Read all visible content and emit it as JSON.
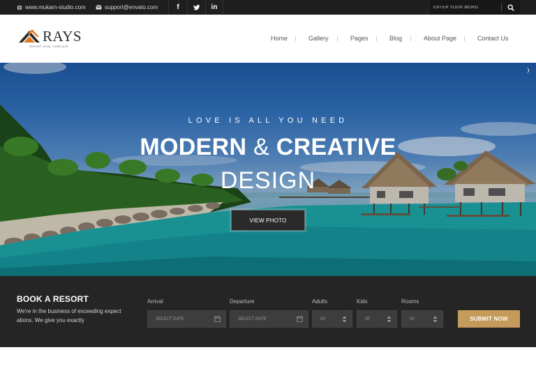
{
  "topbar": {
    "website": "www.mukam-studio.com",
    "email": "support@envato.com",
    "social": [
      {
        "icon": "facebook-icon",
        "glyph": "f"
      },
      {
        "icon": "twitter-icon",
        "glyph": "t"
      },
      {
        "icon": "linkedin-icon",
        "glyph": "in"
      }
    ],
    "search_placeholder": "ENTER YOUR WORD"
  },
  "header": {
    "logo_word": "RAYS",
    "logo_tagline": "RESORT HTML TEMPLATE",
    "nav": [
      "Home",
      "Gallery",
      "Pages",
      "Blog",
      "About Page",
      "Contact Us"
    ]
  },
  "hero": {
    "kicker": "LOVE IS ALL YOU NEED",
    "title_part1": "MODERN",
    "title_amp": "&",
    "title_part2": "CREATIVE",
    "subtitle": "DESIGN",
    "button_label": "VIEW PHOTO"
  },
  "booking": {
    "title": "BOOK A RESORT",
    "description": "We're in the business of exceeding expect ations. We give you exactly",
    "fields": {
      "arrival": {
        "label": "Arrival",
        "placeholder": "SELECT DATE"
      },
      "departure": {
        "label": "Departure",
        "placeholder": "SELECT DATE"
      },
      "adults": {
        "label": "Adults",
        "value": "00"
      },
      "kids": {
        "label": "Kids",
        "value": "00"
      },
      "rooms": {
        "label": "Rooms",
        "value": "00"
      }
    },
    "submit_label": "SUBMIT NOW"
  },
  "colors": {
    "topbar_bg": "#1f1f1f",
    "booking_bg": "#252525",
    "accent": "#c49b5a",
    "logo_orange": "#e07a1f"
  }
}
